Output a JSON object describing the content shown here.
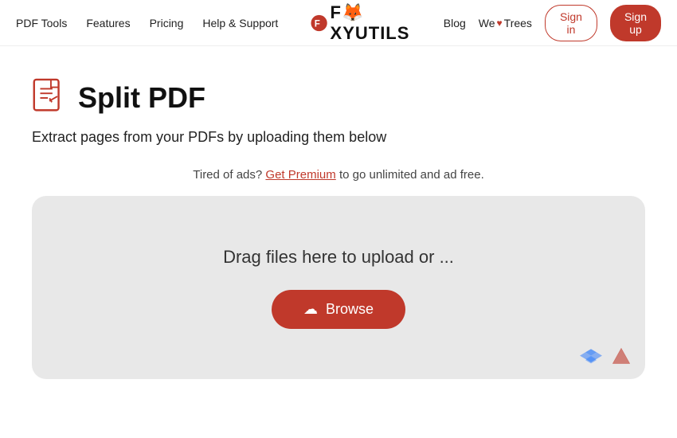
{
  "nav": {
    "links": [
      {
        "id": "pdf-tools",
        "label": "PDF Tools"
      },
      {
        "id": "features",
        "label": "Features"
      },
      {
        "id": "pricing",
        "label": "Pricing"
      },
      {
        "id": "help-support",
        "label": "Help & Support"
      }
    ],
    "logo_text_1": "F",
    "logo_text_2": "XYUTILS",
    "right_links": [
      {
        "id": "blog",
        "label": "Blog"
      }
    ],
    "we_trees": "We♥Trees",
    "signin_label": "Sign in",
    "signup_label": "Sign up"
  },
  "page": {
    "title": "Split PDF",
    "subtitle": "Extract pages from your PDFs by uploading them below",
    "ads_text": "Tired of ads?",
    "ads_link": "Get Premium",
    "ads_suffix": " to go unlimited and ad free.",
    "drop_text": "Drag files here to upload or ...",
    "browse_label": "Browse"
  }
}
